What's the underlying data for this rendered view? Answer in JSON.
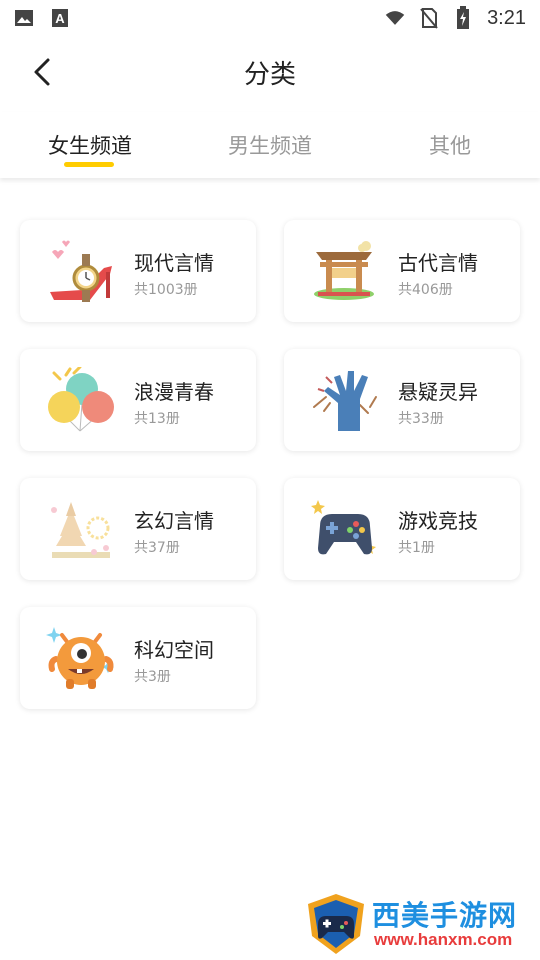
{
  "status_bar": {
    "time": "3:21",
    "left_icons": [
      "image-icon",
      "font-a-icon"
    ],
    "right_icons": [
      "wifi-icon",
      "no-sim-icon",
      "battery-charging-icon"
    ]
  },
  "header": {
    "title": "分类",
    "back_icon": "chevron-left-icon"
  },
  "tabs": [
    {
      "label": "女生频道",
      "active": true
    },
    {
      "label": "男生频道",
      "active": false
    },
    {
      "label": "其他",
      "active": false
    }
  ],
  "colors": {
    "accent": "#FFCC00",
    "text_primary": "#222222",
    "text_secondary": "#999999"
  },
  "categories": [
    {
      "name": "现代言情",
      "count": "共1003册",
      "icon": "high-heel-watch-icon"
    },
    {
      "name": "古代言情",
      "count": "共406册",
      "icon": "ancient-gate-icon"
    },
    {
      "name": "浪漫青春",
      "count": "共13册",
      "icon": "balloons-icon"
    },
    {
      "name": "悬疑灵异",
      "count": "共33册",
      "icon": "zombie-hand-icon"
    },
    {
      "name": "玄幻言情",
      "count": "共37册",
      "icon": "pagoda-icon"
    },
    {
      "name": "游戏竞技",
      "count": "共1册",
      "icon": "gamepad-icon"
    },
    {
      "name": "科幻空间",
      "count": "共3册",
      "icon": "alien-monster-icon"
    }
  ],
  "watermark": {
    "title": "西美手游网",
    "url": "www.hanxm.com"
  }
}
